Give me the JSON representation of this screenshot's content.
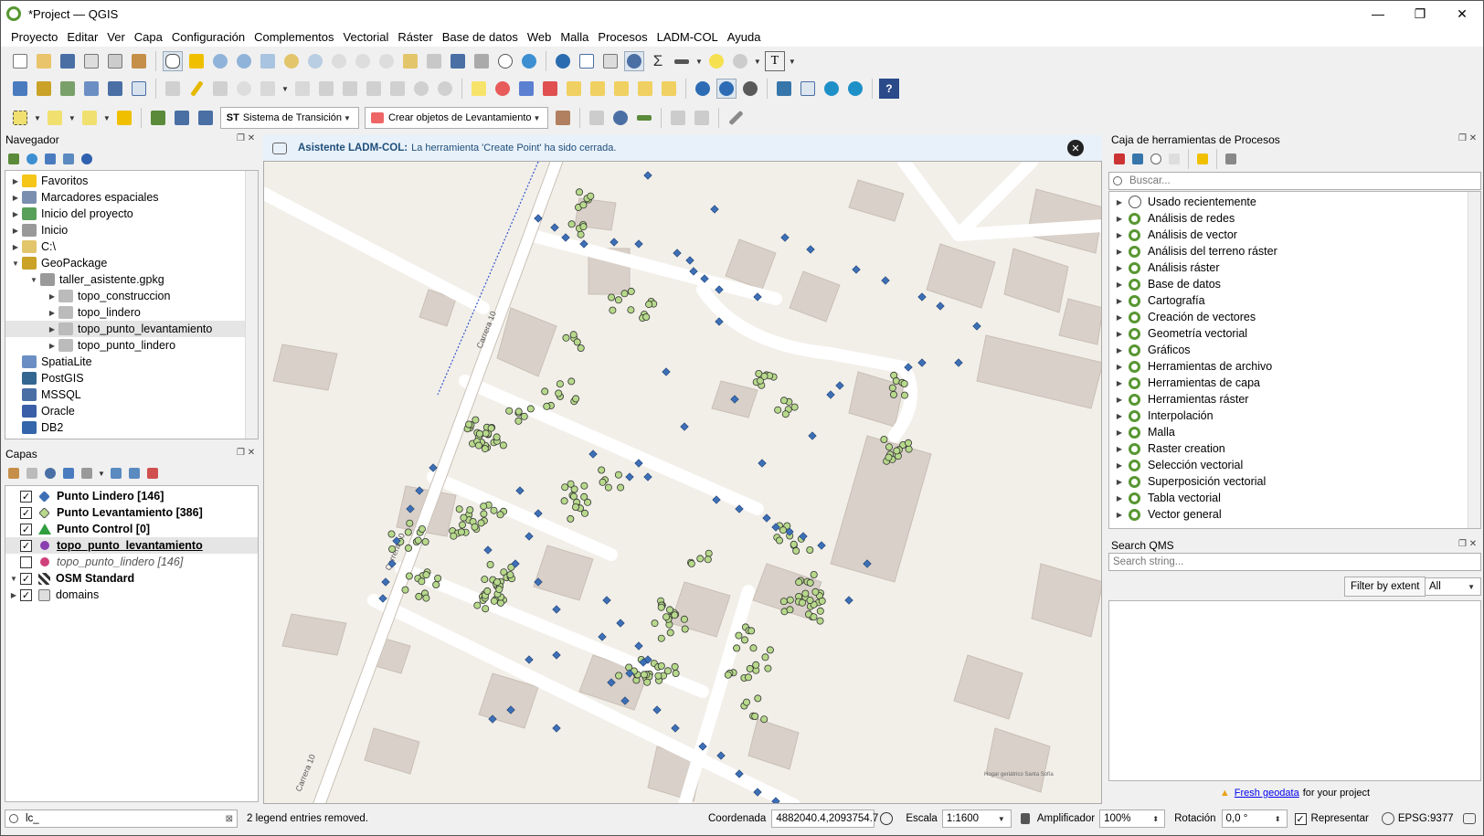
{
  "window": {
    "title": "*Project — QGIS"
  },
  "menu": [
    "Proyecto",
    "Editar",
    "Ver",
    "Capa",
    "Configuración",
    "Complementos",
    "Vectorial",
    "Ráster",
    "Base de datos",
    "Web",
    "Malla",
    "Procesos",
    "LADM-COL",
    "Ayuda"
  ],
  "toolbar3": {
    "st_label": "ST",
    "st_combo": "Sistema de Transición",
    "levantamiento_combo": "Crear objetos de Levantamiento"
  },
  "navigator": {
    "title": "Navegador",
    "items": [
      {
        "label": "Favoritos",
        "icon": "star-icon",
        "color": "#f5c518",
        "indent": 0,
        "expand": "▶"
      },
      {
        "label": "Marcadores espaciales",
        "icon": "bookmark-icon",
        "color": "#7a8fb0",
        "indent": 0,
        "expand": "▶"
      },
      {
        "label": "Inicio del proyecto",
        "icon": "project-home-icon",
        "color": "#58a05a",
        "indent": 0,
        "expand": "▶"
      },
      {
        "label": "Inicio",
        "icon": "home-icon",
        "color": "#999999",
        "indent": 0,
        "expand": "▶"
      },
      {
        "label": "C:\\",
        "icon": "folder-icon",
        "color": "#e3c66c",
        "indent": 0,
        "expand": "▶"
      },
      {
        "label": "GeoPackage",
        "icon": "geopackage-icon",
        "color": "#c9a227",
        "indent": 0,
        "expand": "▼"
      },
      {
        "label": "taller_asistente.gpkg",
        "icon": "database-icon",
        "color": "#9a9a9a",
        "indent": 1,
        "expand": "▼"
      },
      {
        "label": "topo_construccion",
        "icon": "polygon-layer-icon",
        "color": "#bbbbbb",
        "indent": 2,
        "expand": "▶"
      },
      {
        "label": "topo_lindero",
        "icon": "line-layer-icon",
        "color": "#bbbbbb",
        "indent": 2,
        "expand": "▶"
      },
      {
        "label": "topo_punto_levantamiento",
        "icon": "point-layer-icon",
        "color": "#bbbbbb",
        "indent": 2,
        "expand": "▶"
      },
      {
        "label": "topo_punto_lindero",
        "icon": "point-layer-icon",
        "color": "#bbbbbb",
        "indent": 2,
        "expand": "▶"
      },
      {
        "label": "SpatiaLite",
        "icon": "spatialite-icon",
        "color": "#6b8fc4",
        "indent": 0,
        "expand": ""
      },
      {
        "label": "PostGIS",
        "icon": "postgis-icon",
        "color": "#336791",
        "indent": 0,
        "expand": ""
      },
      {
        "label": "MSSQL",
        "icon": "mssql-icon",
        "color": "#4a6fa5",
        "indent": 0,
        "expand": ""
      },
      {
        "label": "Oracle",
        "icon": "oracle-icon",
        "color": "#3b5ea8",
        "indent": 0,
        "expand": ""
      },
      {
        "label": "DB2",
        "icon": "db2-icon",
        "color": "#3366aa",
        "indent": 0,
        "expand": ""
      }
    ]
  },
  "layers": {
    "title": "Capas",
    "items": [
      {
        "label": "Punto Lindero [146]",
        "checked": "✓",
        "icon": "blue-diamond-icon",
        "style": "bold",
        "expand": ""
      },
      {
        "label": "Punto Levantamiento [386]",
        "checked": "✓",
        "icon": "green-diamond-icon",
        "style": "bold",
        "expand": ""
      },
      {
        "label": "Punto Control [0]",
        "checked": "✓",
        "icon": "green-triangle-icon",
        "style": "bold",
        "expand": ""
      },
      {
        "label": "topo_punto_levantamiento",
        "checked": "✓",
        "icon": "purple-circle-icon",
        "style": "bold-underline",
        "expand": ""
      },
      {
        "label": "topo_punto_lindero [146]",
        "checked": "",
        "icon": "pink-circle-icon",
        "style": "italic",
        "expand": ""
      },
      {
        "label": "OSM Standard",
        "checked": "✓",
        "icon": "osm-grid-icon",
        "style": "bold",
        "expand": "▼"
      },
      {
        "label": "domains",
        "checked": "✓",
        "icon": "group-icon",
        "style": "normal",
        "expand": "▶"
      }
    ]
  },
  "message": {
    "title": "Asistente LADM-COL:",
    "text": "La herramienta 'Create Point' ha sido cerrada."
  },
  "map_labels": [
    "Carrera 10",
    "Carrera 10",
    "Carrera 10",
    "Hogar geriátrico Santa Sofía"
  ],
  "processing": {
    "title": "Caja de herramientas de Procesos",
    "search_placeholder": "Buscar...",
    "items": [
      "Usado recientemente",
      "Análisis de redes",
      "Análisis de vector",
      "Análisis del terreno ráster",
      "Análisis ráster",
      "Base de datos",
      "Cartografía",
      "Creación de vectores",
      "Geometría vectorial",
      "Gráficos",
      "Herramientas de archivo",
      "Herramientas de capa",
      "Herramientas ráster",
      "Interpolación",
      "Malla",
      "Raster creation",
      "Selección vectorial",
      "Superposición vectorial",
      "Tabla vectorial",
      "Vector general"
    ]
  },
  "qms": {
    "title": "Search QMS",
    "placeholder": "Search string...",
    "filter_button": "Filter by extent",
    "filter_value": "All",
    "footer_link": "Fresh geodata",
    "footer_text": "for your project"
  },
  "status": {
    "locator_value": "lc_",
    "message": "2 legend entries removed.",
    "coord_label": "Coordenada",
    "coord_value": "4882040.4,2093754.7",
    "scale_label": "Escala",
    "scale_value": "1:1600",
    "magnifier_label": "Amplificador",
    "magnifier_value": "100%",
    "rotation_label": "Rotación",
    "rotation_value": "0,0 °",
    "render_label": "Representar",
    "render_checked": "✓",
    "crs": "EPSG:9377"
  },
  "colors": {
    "blue_point": "#3d6fb6",
    "green_point": "#b7d98b",
    "accent": "#589632"
  }
}
